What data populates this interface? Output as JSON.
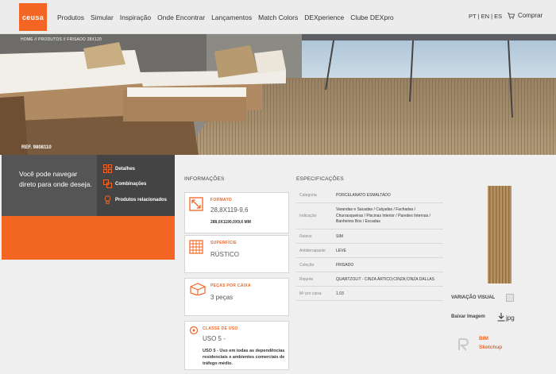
{
  "header": {
    "logo_text": "ceusa",
    "nav": [
      "Produtos",
      "Simular",
      "Inspiração",
      "Onde Encontrar",
      "Lançamentos",
      "Match Colors",
      "DEXperience",
      "Clube DEXpro"
    ],
    "lang": "PT | EN | ES",
    "cart_label": "Comprar"
  },
  "hero": {
    "breadcrumb": "HOME // PRODUTOS // FRISADO 28X120",
    "product_code": "REF. 9808110"
  },
  "sidebar_nav": {
    "text": "Você pode navegar direto para onde deseja.",
    "links": [
      "Detalhes",
      "Combinações",
      "Produtos relacionados"
    ]
  },
  "info": {
    "title": "INFORMAÇÕES",
    "cards": [
      {
        "label": "FORMATO",
        "value": "28,8X119-9,6",
        "sub": "288,0X1190,0X9,6 MM"
      },
      {
        "label": "SUPERFÍCIE",
        "value": "RÚSTICO"
      },
      {
        "label": "PEÇAS POR CAIXA",
        "value": "3 peças"
      },
      {
        "label": "CLASSE DE USO",
        "value": "USO 5 -",
        "desc": "USO 5 - Uso em todas as dependências residenciais e ambientes comerciais de tráfego médio."
      }
    ]
  },
  "specs": {
    "title": "ESPECIFICAÇÕES",
    "rows": [
      {
        "k": "Categoria",
        "v": "PORCELANATO ESMALTADO"
      },
      {
        "k": "Indicação",
        "v": "Varandas e Sacadas / Calçadas / Fachadas / Churrasqueiras / Piscinas Interior / Paredes Internas / Banheiros Box / Escadas"
      },
      {
        "k": "Relevo",
        "v": "SIM"
      },
      {
        "k": "Antiderrapante",
        "v": "LEVE"
      },
      {
        "k": "Coleção",
        "v": "FRISADO"
      },
      {
        "k": "Rejunte",
        "v": "QUARTZOLIT - CINZA ÁRTICO;CINZA;CINZA DALLAS"
      },
      {
        "k": "M² por caixa",
        "v": "1.03"
      }
    ]
  },
  "right": {
    "variation_label": "VARIAÇÃO VISUAL",
    "download_label": "Baixar Imagem",
    "download_format": "jpg",
    "bim_line1": "BIM",
    "bim_line2": "Sketchup"
  }
}
